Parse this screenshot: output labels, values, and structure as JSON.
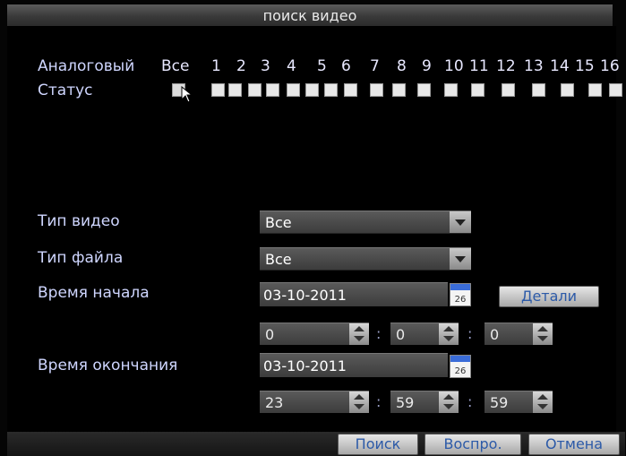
{
  "window": {
    "title": "поиск видео"
  },
  "channels": {
    "label": "Аналоговый",
    "all_label": "Все",
    "numbers": [
      "1",
      "2",
      "3",
      "4",
      "5",
      "6",
      "7",
      "8",
      "9",
      "10",
      "11",
      "12",
      "13",
      "14",
      "15",
      "16"
    ],
    "status_label": "Статус"
  },
  "fields": {
    "video_type": {
      "label": "Тип видео",
      "value": "Все"
    },
    "file_type": {
      "label": "Тип файла",
      "value": "Все"
    },
    "start_time": {
      "label": "Время начала",
      "date": "03-10-2011",
      "hour": "0",
      "minute": "0",
      "second": "0",
      "calendar_day": "26"
    },
    "end_time": {
      "label": "Время окончания",
      "date": "03-10-2011",
      "hour": "23",
      "minute": "59",
      "second": "59",
      "calendar_day": "26"
    },
    "time_separator": ":"
  },
  "buttons": {
    "details": "Детали",
    "search": "Поиск",
    "play": "Воспро.",
    "cancel": "Отмена"
  }
}
